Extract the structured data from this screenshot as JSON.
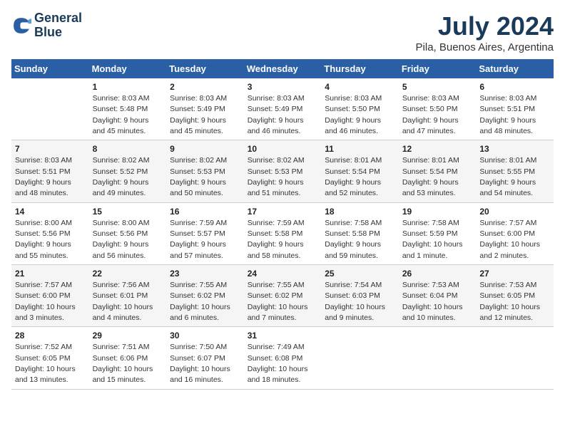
{
  "header": {
    "logo_line1": "General",
    "logo_line2": "Blue",
    "title": "July 2024",
    "subtitle": "Pila, Buenos Aires, Argentina"
  },
  "columns": [
    "Sunday",
    "Monday",
    "Tuesday",
    "Wednesday",
    "Thursday",
    "Friday",
    "Saturday"
  ],
  "weeks": [
    [
      {
        "day": "",
        "info": ""
      },
      {
        "day": "1",
        "info": "Sunrise: 8:03 AM\nSunset: 5:48 PM\nDaylight: 9 hours\nand 45 minutes."
      },
      {
        "day": "2",
        "info": "Sunrise: 8:03 AM\nSunset: 5:49 PM\nDaylight: 9 hours\nand 45 minutes."
      },
      {
        "day": "3",
        "info": "Sunrise: 8:03 AM\nSunset: 5:49 PM\nDaylight: 9 hours\nand 46 minutes."
      },
      {
        "day": "4",
        "info": "Sunrise: 8:03 AM\nSunset: 5:50 PM\nDaylight: 9 hours\nand 46 minutes."
      },
      {
        "day": "5",
        "info": "Sunrise: 8:03 AM\nSunset: 5:50 PM\nDaylight: 9 hours\nand 47 minutes."
      },
      {
        "day": "6",
        "info": "Sunrise: 8:03 AM\nSunset: 5:51 PM\nDaylight: 9 hours\nand 48 minutes."
      }
    ],
    [
      {
        "day": "7",
        "info": "Sunrise: 8:03 AM\nSunset: 5:51 PM\nDaylight: 9 hours\nand 48 minutes."
      },
      {
        "day": "8",
        "info": "Sunrise: 8:02 AM\nSunset: 5:52 PM\nDaylight: 9 hours\nand 49 minutes."
      },
      {
        "day": "9",
        "info": "Sunrise: 8:02 AM\nSunset: 5:53 PM\nDaylight: 9 hours\nand 50 minutes."
      },
      {
        "day": "10",
        "info": "Sunrise: 8:02 AM\nSunset: 5:53 PM\nDaylight: 9 hours\nand 51 minutes."
      },
      {
        "day": "11",
        "info": "Sunrise: 8:01 AM\nSunset: 5:54 PM\nDaylight: 9 hours\nand 52 minutes."
      },
      {
        "day": "12",
        "info": "Sunrise: 8:01 AM\nSunset: 5:54 PM\nDaylight: 9 hours\nand 53 minutes."
      },
      {
        "day": "13",
        "info": "Sunrise: 8:01 AM\nSunset: 5:55 PM\nDaylight: 9 hours\nand 54 minutes."
      }
    ],
    [
      {
        "day": "14",
        "info": "Sunrise: 8:00 AM\nSunset: 5:56 PM\nDaylight: 9 hours\nand 55 minutes."
      },
      {
        "day": "15",
        "info": "Sunrise: 8:00 AM\nSunset: 5:56 PM\nDaylight: 9 hours\nand 56 minutes."
      },
      {
        "day": "16",
        "info": "Sunrise: 7:59 AM\nSunset: 5:57 PM\nDaylight: 9 hours\nand 57 minutes."
      },
      {
        "day": "17",
        "info": "Sunrise: 7:59 AM\nSunset: 5:58 PM\nDaylight: 9 hours\nand 58 minutes."
      },
      {
        "day": "18",
        "info": "Sunrise: 7:58 AM\nSunset: 5:58 PM\nDaylight: 9 hours\nand 59 minutes."
      },
      {
        "day": "19",
        "info": "Sunrise: 7:58 AM\nSunset: 5:59 PM\nDaylight: 10 hours\nand 1 minute."
      },
      {
        "day": "20",
        "info": "Sunrise: 7:57 AM\nSunset: 6:00 PM\nDaylight: 10 hours\nand 2 minutes."
      }
    ],
    [
      {
        "day": "21",
        "info": "Sunrise: 7:57 AM\nSunset: 6:00 PM\nDaylight: 10 hours\nand 3 minutes."
      },
      {
        "day": "22",
        "info": "Sunrise: 7:56 AM\nSunset: 6:01 PM\nDaylight: 10 hours\nand 4 minutes."
      },
      {
        "day": "23",
        "info": "Sunrise: 7:55 AM\nSunset: 6:02 PM\nDaylight: 10 hours\nand 6 minutes."
      },
      {
        "day": "24",
        "info": "Sunrise: 7:55 AM\nSunset: 6:02 PM\nDaylight: 10 hours\nand 7 minutes."
      },
      {
        "day": "25",
        "info": "Sunrise: 7:54 AM\nSunset: 6:03 PM\nDaylight: 10 hours\nand 9 minutes."
      },
      {
        "day": "26",
        "info": "Sunrise: 7:53 AM\nSunset: 6:04 PM\nDaylight: 10 hours\nand 10 minutes."
      },
      {
        "day": "27",
        "info": "Sunrise: 7:53 AM\nSunset: 6:05 PM\nDaylight: 10 hours\nand 12 minutes."
      }
    ],
    [
      {
        "day": "28",
        "info": "Sunrise: 7:52 AM\nSunset: 6:05 PM\nDaylight: 10 hours\nand 13 minutes."
      },
      {
        "day": "29",
        "info": "Sunrise: 7:51 AM\nSunset: 6:06 PM\nDaylight: 10 hours\nand 15 minutes."
      },
      {
        "day": "30",
        "info": "Sunrise: 7:50 AM\nSunset: 6:07 PM\nDaylight: 10 hours\nand 16 minutes."
      },
      {
        "day": "31",
        "info": "Sunrise: 7:49 AM\nSunset: 6:08 PM\nDaylight: 10 hours\nand 18 minutes."
      },
      {
        "day": "",
        "info": ""
      },
      {
        "day": "",
        "info": ""
      },
      {
        "day": "",
        "info": ""
      }
    ]
  ]
}
